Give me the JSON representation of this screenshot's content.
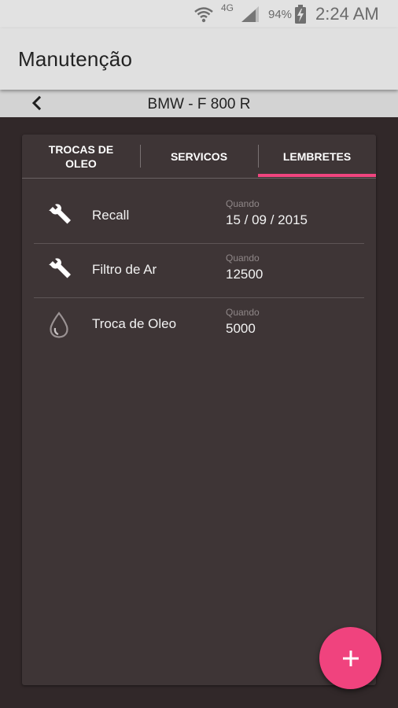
{
  "status_bar": {
    "network": "4G",
    "battery": "94%",
    "time": "2:24 AM",
    "icons": [
      "wifi-icon",
      "signal-icon",
      "battery-charging-icon"
    ]
  },
  "app_bar": {
    "title": "Manutenção"
  },
  "sub_bar": {
    "vehicle": "BMW - F 800 R",
    "back_icon": "chevron-left-icon"
  },
  "tabs": [
    {
      "label": "TROCAS DE OLEO",
      "line1": "TROCAS DE",
      "line2": "OLEO",
      "selected": false
    },
    {
      "label": "SERVICOS",
      "selected": false
    },
    {
      "label": "LEMBRETES",
      "selected": true
    }
  ],
  "reminders": [
    {
      "name": "Recall",
      "when_label": "Quando",
      "when_value": "15 / 09 / 2015",
      "icon": "wrench-icon"
    },
    {
      "name": "Filtro de Ar",
      "when_label": "Quando",
      "when_value": "12500",
      "icon": "wrench-icon"
    },
    {
      "name": "Troca de Oleo",
      "when_label": "Quando",
      "when_value": "5000",
      "icon": "oil-drop-icon"
    }
  ],
  "fab": {
    "label": "+",
    "icon": "add-icon"
  },
  "colors": {
    "accent": "#f0457f",
    "background": "#312829",
    "card": "#3e3536",
    "app_bar": "#e0e0e0",
    "sub_bar": "#d3d3d3"
  }
}
